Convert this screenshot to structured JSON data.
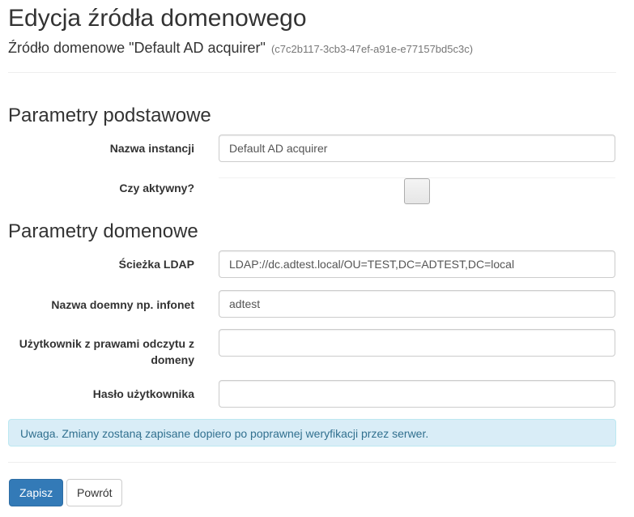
{
  "header": {
    "title": "Edycja źródła domenowego",
    "subtitle": "Źródło domenowe \"Default AD acquirer\"",
    "guid": "(c7c2b117-3cb3-47ef-a91e-e77157bd5c3c)"
  },
  "basic": {
    "section_title": "Parametry podstawowe",
    "instance_label": "Nazwa instancji",
    "instance_value": "Default AD acquirer",
    "active_label": "Czy aktywny?",
    "active_checked": false
  },
  "domain": {
    "section_title": "Parametry domenowe",
    "ldap_label": "Ścieżka LDAP",
    "ldap_value": "LDAP://dc.adtest.local/OU=TEST,DC=ADTEST,DC=local",
    "domain_name_label": "Nazwa doemny np. infonet",
    "domain_name_value": "adtest",
    "user_label": "Użytkownik z prawami odczytu z domeny",
    "user_value": "",
    "password_label": "Hasło użytkownika",
    "password_value": ""
  },
  "alert": {
    "text": "Uwaga. Zmiany zostaną zapisane dopiero po poprawnej weryfikacji przez serwer."
  },
  "actions": {
    "save_label": "Zapisz",
    "back_label": "Powrót"
  }
}
